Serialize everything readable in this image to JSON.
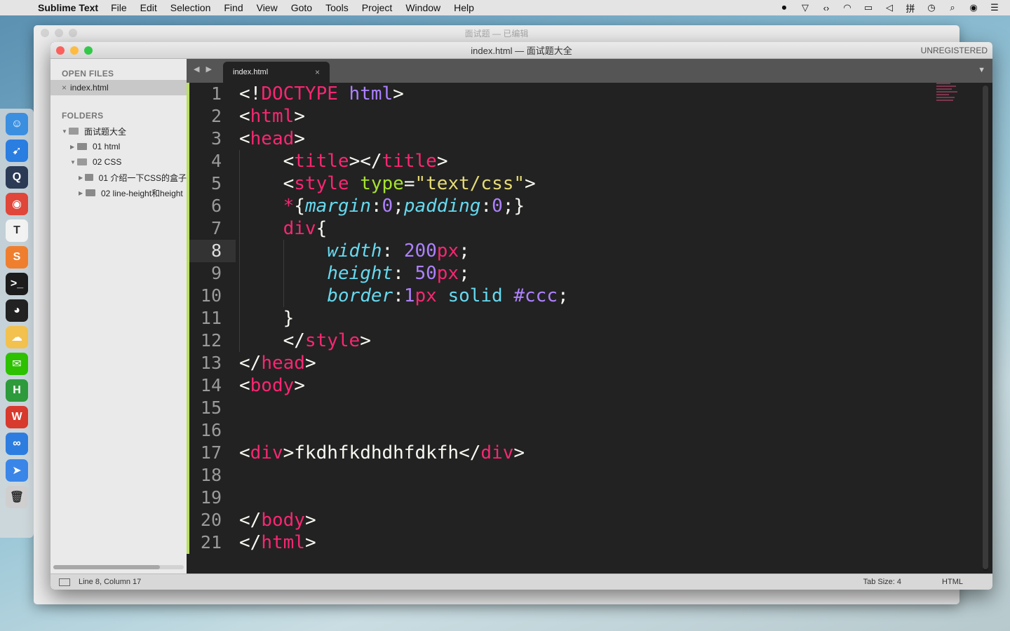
{
  "menubar": {
    "apple_glyph": "",
    "app_name": "Sublime Text",
    "items": [
      "File",
      "Edit",
      "Selection",
      "Find",
      "View",
      "Goto",
      "Tools",
      "Project",
      "Window",
      "Help"
    ],
    "status_icons": [
      "record-icon",
      "vim-icon",
      "code-icon",
      "wifi-icon",
      "battery-icon",
      "volume-icon",
      "input-method-icon",
      "clock-icon",
      "spotlight-icon",
      "siri-icon",
      "notification-center-icon"
    ]
  },
  "background_window": {
    "title": "面试题 — 已编辑"
  },
  "window": {
    "title": "index.html — 面试题大全",
    "unregistered": "UNREGISTERED"
  },
  "sidebar": {
    "open_files_heading": "OPEN FILES",
    "open_files": [
      {
        "close": "×",
        "name": "index.html"
      }
    ],
    "folders_heading": "FOLDERS",
    "tree": [
      {
        "label": "面试题大全",
        "expanded": true,
        "depth": 0
      },
      {
        "label": "01 html",
        "expanded": false,
        "depth": 1
      },
      {
        "label": "02 CSS",
        "expanded": true,
        "depth": 1
      },
      {
        "label": "01 介绍一下CSS的盒子",
        "expanded": false,
        "depth": 2
      },
      {
        "label": "02 line-height和height",
        "expanded": false,
        "depth": 2
      }
    ]
  },
  "tabbar": {
    "nav_arrows": "◀ ▶",
    "active_tab": "index.html",
    "tab_close": "×",
    "dropdown": "▼"
  },
  "editor": {
    "line_numbers": [
      "1",
      "2",
      "3",
      "4",
      "5",
      "6",
      "7",
      "8",
      "9",
      "10",
      "11",
      "12",
      "13",
      "14",
      "15",
      "16",
      "17",
      "18",
      "19",
      "20",
      "21"
    ],
    "active_line": 8,
    "lines": [
      [
        [
          "t-def",
          "<!"
        ],
        [
          "t-tag",
          "DOCTYPE"
        ],
        [
          "t-def",
          " "
        ],
        [
          "t-kw",
          "html"
        ],
        [
          "t-def",
          ">"
        ]
      ],
      [
        [
          "t-def",
          "<"
        ],
        [
          "t-tag",
          "html"
        ],
        [
          "t-def",
          ">"
        ]
      ],
      [
        [
          "t-def",
          "<"
        ],
        [
          "t-tag",
          "head"
        ],
        [
          "t-def",
          ">"
        ]
      ],
      [
        [
          "t-def",
          "    <"
        ],
        [
          "t-tag",
          "title"
        ],
        [
          "t-def",
          "></"
        ],
        [
          "t-tag",
          "title"
        ],
        [
          "t-def",
          ">"
        ]
      ],
      [
        [
          "t-def",
          "    <"
        ],
        [
          "t-tag",
          "style"
        ],
        [
          "t-def",
          " "
        ],
        [
          "t-attr",
          "type"
        ],
        [
          "t-def",
          "="
        ],
        [
          "t-str",
          "\"text/css\""
        ],
        [
          "t-def",
          ">"
        ]
      ],
      [
        [
          "t-def",
          "    "
        ],
        [
          "t-tag",
          "*"
        ],
        [
          "t-def",
          "{"
        ],
        [
          "t-prop",
          "margin"
        ],
        [
          "t-def",
          ":"
        ],
        [
          "t-num",
          "0"
        ],
        [
          "t-def",
          ";"
        ],
        [
          "t-prop",
          "padding"
        ],
        [
          "t-def",
          ":"
        ],
        [
          "t-num",
          "0"
        ],
        [
          "t-def",
          ";}"
        ]
      ],
      [
        [
          "t-def",
          "    "
        ],
        [
          "t-tag",
          "div"
        ],
        [
          "t-def",
          "{"
        ]
      ],
      [
        [
          "t-def",
          "        "
        ],
        [
          "t-prop",
          "width"
        ],
        [
          "t-def",
          ": "
        ],
        [
          "t-num",
          "200"
        ],
        [
          "t-unit",
          "px"
        ],
        [
          "t-def",
          ";"
        ]
      ],
      [
        [
          "t-def",
          "        "
        ],
        [
          "t-prop",
          "height"
        ],
        [
          "t-def",
          ": "
        ],
        [
          "t-num",
          "50"
        ],
        [
          "t-unit",
          "px"
        ],
        [
          "t-def",
          ";"
        ]
      ],
      [
        [
          "t-def",
          "        "
        ],
        [
          "t-prop",
          "border"
        ],
        [
          "t-def",
          ":"
        ],
        [
          "t-num",
          "1"
        ],
        [
          "t-unit",
          "px"
        ],
        [
          "t-def",
          " "
        ],
        [
          "t-val",
          "solid"
        ],
        [
          "t-def",
          " "
        ],
        [
          "t-kw",
          "#ccc"
        ],
        [
          "t-def",
          ";"
        ]
      ],
      [
        [
          "t-def",
          "    }"
        ]
      ],
      [
        [
          "t-def",
          "    </"
        ],
        [
          "t-tag",
          "style"
        ],
        [
          "t-def",
          ">"
        ]
      ],
      [
        [
          "t-def",
          "</"
        ],
        [
          "t-tag",
          "head"
        ],
        [
          "t-def",
          ">"
        ]
      ],
      [
        [
          "t-def",
          "<"
        ],
        [
          "t-tag",
          "body"
        ],
        [
          "t-def",
          ">"
        ]
      ],
      [],
      [],
      [
        [
          "t-def",
          "<"
        ],
        [
          "t-tag",
          "div"
        ],
        [
          "t-def",
          ">fkdhfkdhdhfdkfh</"
        ],
        [
          "t-tag",
          "div"
        ],
        [
          "t-def",
          ">"
        ]
      ],
      [],
      [],
      [
        [
          "t-def",
          "</"
        ],
        [
          "t-tag",
          "body"
        ],
        [
          "t-def",
          ">"
        ]
      ],
      [
        [
          "t-def",
          "</"
        ],
        [
          "t-tag",
          "html"
        ],
        [
          "t-def",
          ">"
        ]
      ]
    ]
  },
  "statusbar": {
    "position": "Line 8, Column 17",
    "tab_size": "Tab Size: 4",
    "syntax": "HTML"
  },
  "dock": {
    "apps": [
      {
        "name": "finder-icon",
        "glyph": "☺",
        "color": "#3b8fe0"
      },
      {
        "name": "safari-icon",
        "glyph": "➹",
        "color": "#2a7de1"
      },
      {
        "name": "quicktime-icon",
        "glyph": "Q",
        "color": "#2b3a55"
      },
      {
        "name": "chrome-icon",
        "glyph": "◉",
        "color": "#e0463a"
      },
      {
        "name": "typora-icon",
        "glyph": "T",
        "color": "#f2f2f2"
      },
      {
        "name": "sublime-icon",
        "glyph": "S",
        "color": "#ef7f2e"
      },
      {
        "name": "terminal-icon",
        "glyph": ">_",
        "color": "#1c1c1c"
      },
      {
        "name": "qq-icon",
        "glyph": "◕",
        "color": "#222222"
      },
      {
        "name": "cloud-app-icon",
        "glyph": "☁",
        "color": "#f2c14e"
      },
      {
        "name": "wechat-icon",
        "glyph": "✉",
        "color": "#2dc100"
      },
      {
        "name": "hbuilder-icon",
        "glyph": "H",
        "color": "#2d9b3c"
      },
      {
        "name": "wps-icon",
        "glyph": "W",
        "color": "#d83a2e"
      },
      {
        "name": "baidu-netdisk-icon",
        "glyph": "∞",
        "color": "#2d7de0"
      },
      {
        "name": "feishu-icon",
        "glyph": "➤",
        "color": "#3a86e8"
      },
      {
        "name": "trash-icon",
        "glyph": "🗑",
        "color": "#cfcfcf"
      }
    ]
  }
}
